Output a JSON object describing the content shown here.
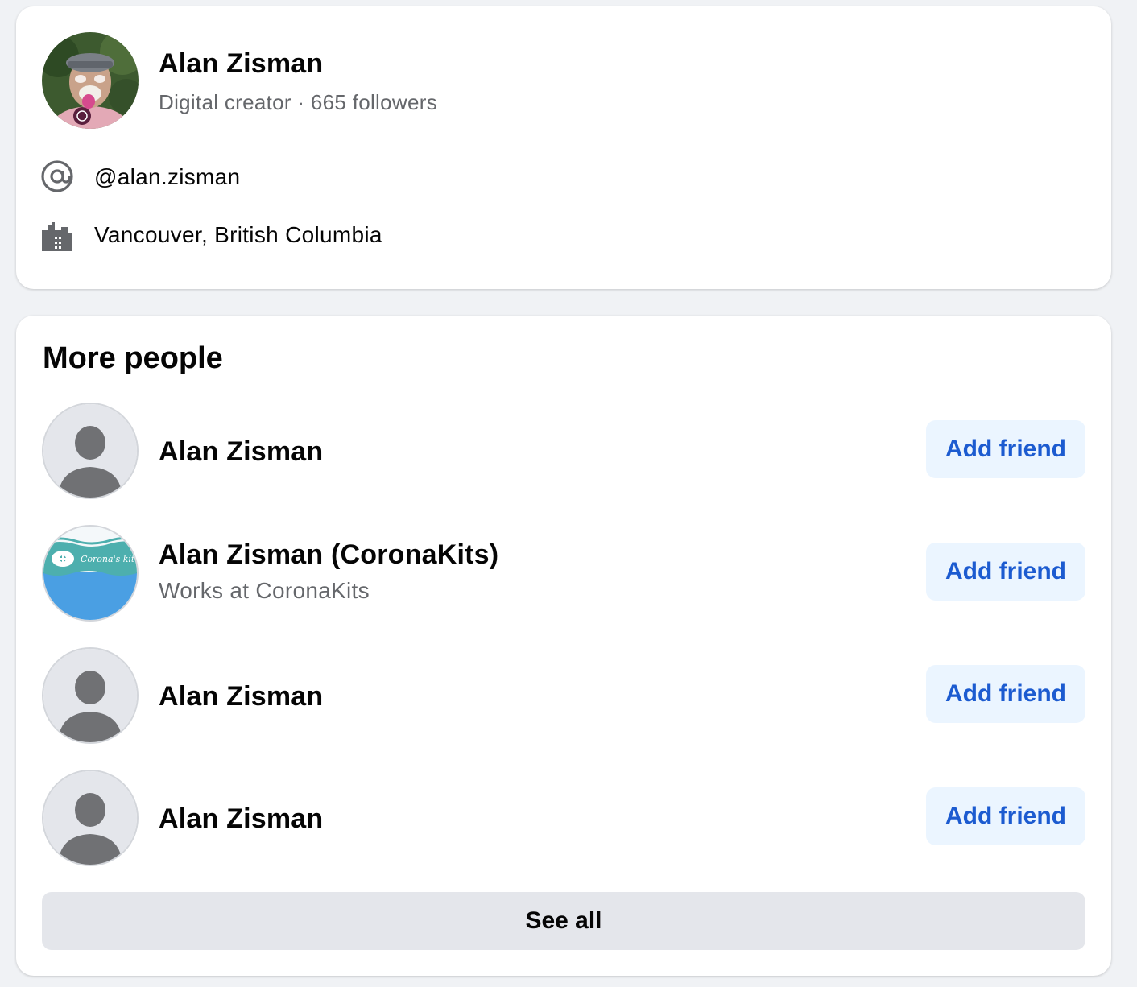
{
  "profile": {
    "name": "Alan Zisman",
    "subtitle": "Digital creator · 665 followers",
    "username": "@alan.zisman",
    "location": "Vancouver, British Columbia"
  },
  "more_people": {
    "title": "More people",
    "people": [
      {
        "name": "Alan Zisman",
        "avatar": "default-silhouette",
        "button": "Add friend"
      },
      {
        "name": "Alan Zisman (CoronaKits)",
        "subtitle": "Works at CoronaKits",
        "avatar": "coronakits-logo",
        "avatar_text": "Corona's kit",
        "button": "Add friend"
      },
      {
        "name": "Alan Zisman",
        "avatar": "default-silhouette",
        "button": "Add friend"
      },
      {
        "name": "Alan Zisman",
        "avatar": "default-silhouette",
        "button": "Add friend"
      }
    ],
    "see_all": "See all"
  },
  "colors": {
    "accent": "#1c5bd0",
    "button_bg": "#ebf5ff",
    "secondary_text": "#65676b",
    "page_bg": "#f0f2f5"
  }
}
